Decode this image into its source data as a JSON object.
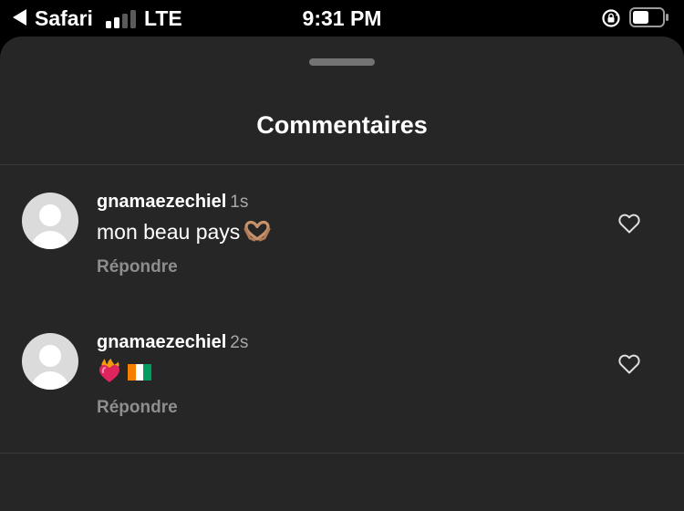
{
  "status_bar": {
    "back_app": "Safari",
    "network": "LTE",
    "time": "9:31 PM",
    "signal_bars_active": 2,
    "signal_bars_total": 4,
    "battery_level": 0.5
  },
  "sheet": {
    "title": "Commentaires"
  },
  "comments": [
    {
      "username": "gnamaezechiel",
      "time": "1s",
      "text": "mon beau pays",
      "emoji_icons": [
        "heart-hands-icon"
      ],
      "reply_label": "Répondre"
    },
    {
      "username": "gnamaezechiel",
      "time": "2s",
      "text": "",
      "emoji_icons": [
        "heart-on-fire-icon",
        "ivory-coast-flag-icon"
      ],
      "reply_label": "Répondre"
    }
  ],
  "colors": {
    "sheet_background": "#262626",
    "secondary_text": "#a8a8a8",
    "reply_text": "#8e8e8e",
    "divider": "#3a3a3a"
  }
}
